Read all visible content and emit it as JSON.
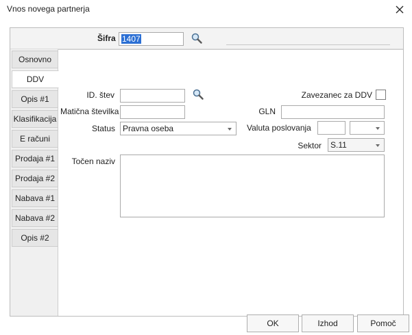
{
  "window": {
    "title": "Vnos novega partnerja"
  },
  "header": {
    "sifra_label": "Šifra",
    "sifra_value": "1407"
  },
  "tabs": [
    {
      "label": "Osnovno"
    },
    {
      "label": "DDV"
    },
    {
      "label": "Opis #1"
    },
    {
      "label": "Klasifikacija"
    },
    {
      "label": "E računi"
    },
    {
      "label": "Prodaja #1"
    },
    {
      "label": "Prodaja #2"
    },
    {
      "label": "Nabava #1"
    },
    {
      "label": "Nabava #2"
    },
    {
      "label": "Opis #2"
    }
  ],
  "active_tab": "DDV",
  "form": {
    "id_stev_label": "ID. štev",
    "id_stev_value": "",
    "zavezanec_label": "Zavezanec za DDV",
    "maticna_label": "Matična številka",
    "maticna_value": "",
    "gln_label": "GLN",
    "gln_value": "",
    "status_label": "Status",
    "status_value": "Pravna oseba",
    "valuta_label": "Valuta poslovanja",
    "valuta_value": "",
    "valuta_select_value": "",
    "sektor_label": "Sektor",
    "sektor_value": "S.11",
    "tocen_naziv_label": "Točen naziv",
    "tocen_naziv_value": ""
  },
  "buttons": {
    "ok": "OK",
    "izhod": "Izhod",
    "pomoc": "Pomoč"
  },
  "colors": {
    "selection": "#2b6fd4",
    "panel": "#ffffff",
    "frame": "#f0f0f0"
  },
  "icons": {
    "close": "close-icon",
    "search": "search-icon",
    "dropdown": "chevron-down-icon"
  }
}
